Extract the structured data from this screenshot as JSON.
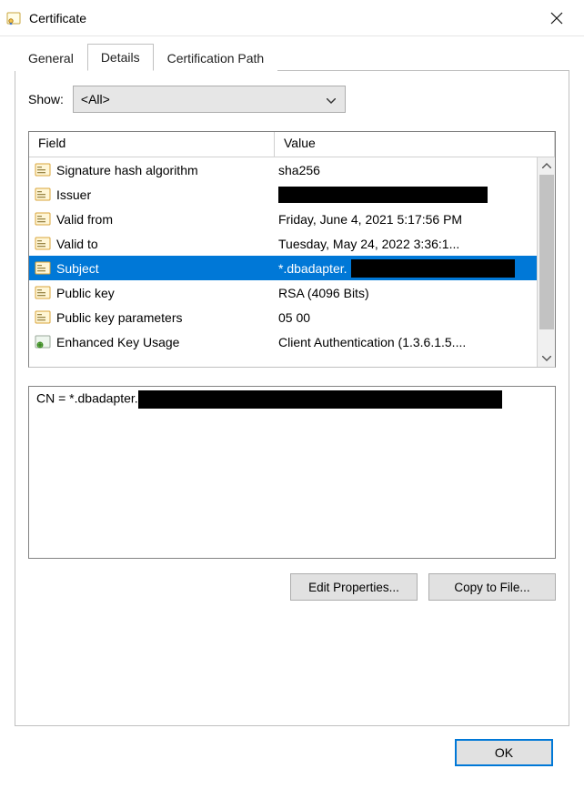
{
  "window": {
    "title": "Certificate"
  },
  "tabs": {
    "general": "General",
    "details": "Details",
    "certpath": "Certification Path"
  },
  "show": {
    "label": "Show:",
    "value": "<All>"
  },
  "columns": {
    "field": "Field",
    "value": "Value"
  },
  "rows": [
    {
      "field": "Signature hash algorithm",
      "value": "sha256",
      "icon": "cert-prop-icon"
    },
    {
      "field": "Issuer",
      "value": "",
      "redacted": true,
      "icon": "cert-prop-icon"
    },
    {
      "field": "Valid from",
      "value": "Friday, June 4, 2021 5:17:56 PM",
      "icon": "cert-prop-icon"
    },
    {
      "field": "Valid to",
      "value": "Tuesday, May 24, 2022 3:36:1...",
      "icon": "cert-prop-icon"
    },
    {
      "field": "Subject",
      "value": "*.dbadapter.",
      "redacted_after": true,
      "selected": true,
      "icon": "cert-prop-icon"
    },
    {
      "field": "Public key",
      "value": "RSA (4096 Bits)",
      "icon": "cert-prop-icon"
    },
    {
      "field": "Public key parameters",
      "value": "05 00",
      "icon": "cert-prop-icon"
    },
    {
      "field": "Enhanced Key Usage",
      "value": "Client Authentication (1.3.6.1.5....",
      "icon": "cert-ext-icon"
    }
  ],
  "details_text": {
    "prefix": "CN = *.dbadapter."
  },
  "buttons": {
    "edit": "Edit Properties...",
    "copy": "Copy to File...",
    "ok": "OK"
  }
}
